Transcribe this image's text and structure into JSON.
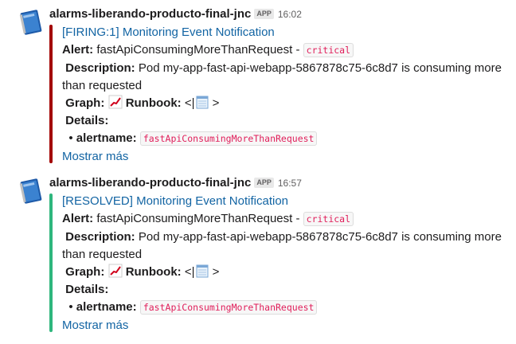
{
  "messages": [
    {
      "sender": "alarms-liberando-producto-final-jnc",
      "badge": "APP",
      "time": "16:02",
      "title": "[FIRING:1] Monitoring Event Notification",
      "alert_label": "Alert:",
      "alert_text": "fastApiConsumingMoreThanRequest - ",
      "severity": "critical",
      "description_label": "Description:",
      "description_line1": "Pod my-app-fast-api-webapp-5867878c75-6c8d7 is consuming more",
      "description_line2": "than requested",
      "graph_label": "Graph:",
      "runbook_label": "Runbook:",
      "runbook_open": "<|",
      "runbook_close": ">",
      "details_label": "Details:",
      "bullet": "•",
      "alertname_label": "alertname:",
      "alertname_value": "fastApiConsumingMoreThanRequest",
      "more": "Mostrar más",
      "bar_color": "#a30200"
    },
    {
      "sender": "alarms-liberando-producto-final-jnc",
      "badge": "APP",
      "time": "16:57",
      "title": "[RESOLVED] Monitoring Event Notification",
      "alert_label": "Alert:",
      "alert_text": "fastApiConsumingMoreThanRequest - ",
      "severity": "critical",
      "description_label": "Description:",
      "description_line1": "Pod my-app-fast-api-webapp-5867878c75-6c8d7 is consuming more",
      "description_line2": "than requested",
      "graph_label": "Graph:",
      "runbook_label": "Runbook:",
      "runbook_open": "<|",
      "runbook_close": ">",
      "details_label": "Details:",
      "bullet": "•",
      "alertname_label": "alertname:",
      "alertname_value": "fastApiConsumingMoreThanRequest",
      "more": "Mostrar más",
      "bar_color": "#2eb67d"
    }
  ],
  "icons": {
    "avatar": "notebook-icon",
    "graph": "chart-increasing-icon",
    "runbook": "notepad-icon"
  }
}
